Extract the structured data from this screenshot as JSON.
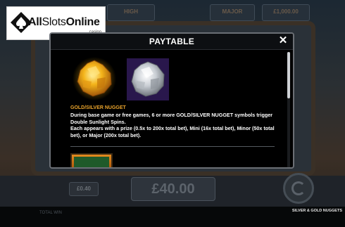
{
  "watermark": {
    "brand_all": "All",
    "brand_slots": "Slots",
    "brand_online": "Online",
    "brand_sub": ".casino"
  },
  "background": {
    "header_labels": [
      "HIGH",
      "MAJOR",
      "£1,000.00"
    ],
    "bet_value": "£0.40",
    "total_value": "£40.00",
    "footer_left": "TOTAL WIN",
    "footer_right": "SILVER & GOLD NUGGETS"
  },
  "paytable": {
    "title": "PAYTABLE",
    "close_label": "✕",
    "symbols": [
      {
        "name": "gold-nugget",
        "color": "#f4b41a"
      },
      {
        "name": "silver-nugget",
        "color": "#d9dde2"
      }
    ],
    "section_title": "GOLD/SILVER NUGGET",
    "description_1": "During base game or free games, 6 or more GOLD/SILVER NUGGET symbols trigger Double Sunlight Spins.",
    "description_2": "Each appears with a prize (0.5x to 200x total bet), Mini (16x total bet), Minor (50x total bet), or Major (200x total bet)."
  },
  "colors": {
    "accent": "#e9a32b",
    "modal_bg": "#000000"
  }
}
